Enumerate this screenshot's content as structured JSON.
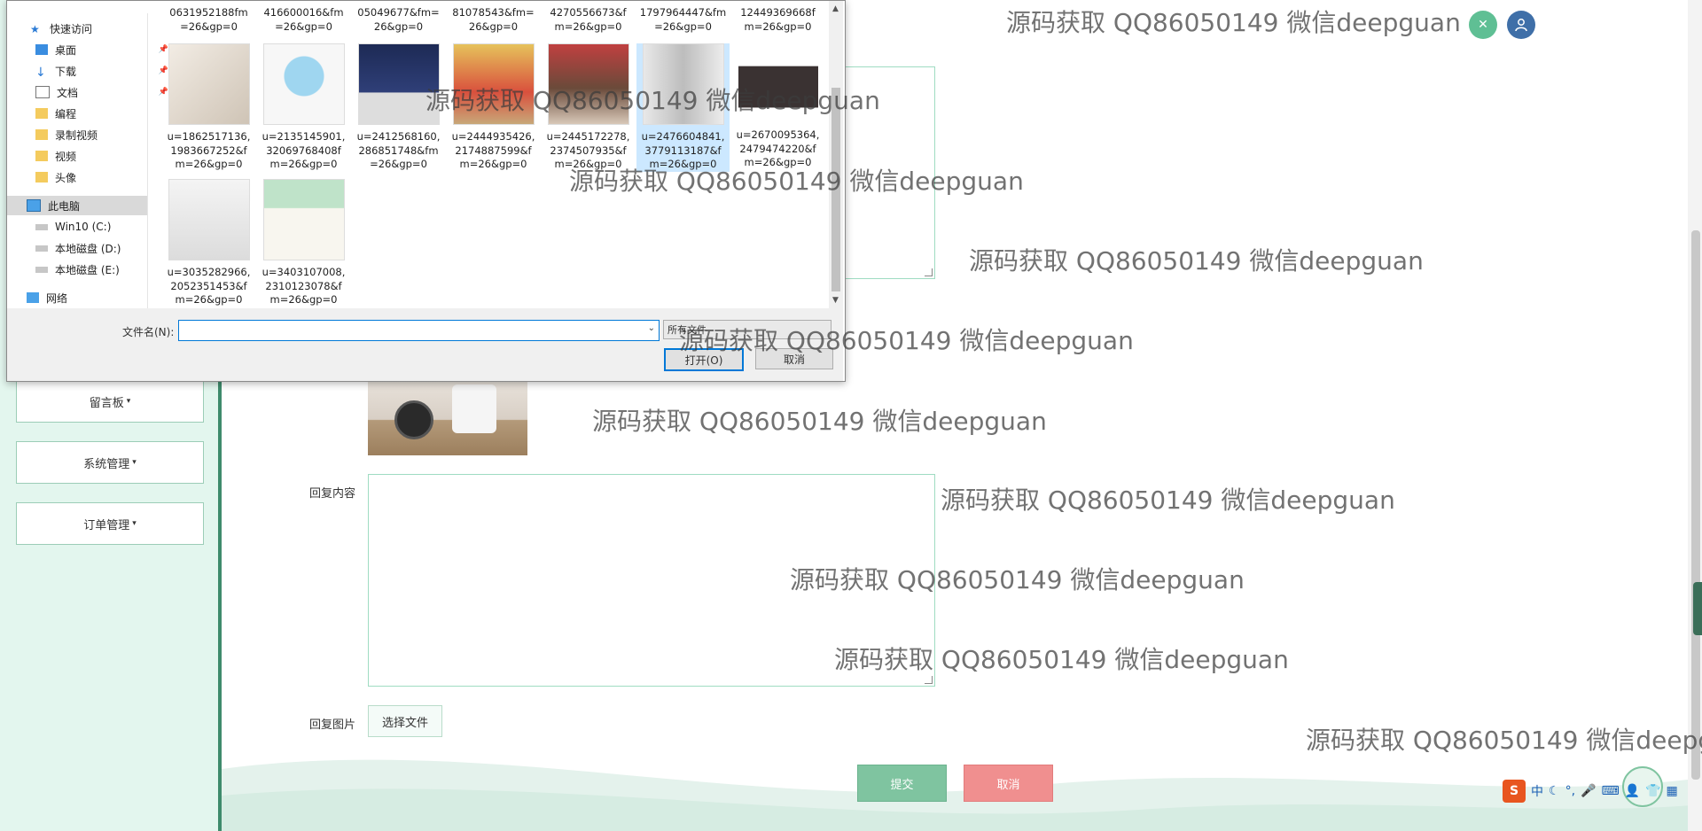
{
  "sidebar": {
    "items": [
      {
        "label": "留言板",
        "caret": "▾"
      },
      {
        "label": "系统管理",
        "caret": "▾"
      },
      {
        "label": "订单管理",
        "caret": "▾"
      }
    ]
  },
  "form": {
    "reply_content_label": "回复内容",
    "reply_image_label": "回复图片",
    "choose_file": "选择文件",
    "submit": "提交",
    "cancel": "取消"
  },
  "header": {
    "close_icon": "✕",
    "user_icon": "user-icon"
  },
  "dialog": {
    "nav": [
      {
        "label": "快速访问",
        "icon": "star-icon"
      },
      {
        "label": "桌面",
        "icon": "desktop-icon",
        "pinned": true
      },
      {
        "label": "下载",
        "icon": "download-icon",
        "pinned": true
      },
      {
        "label": "文档",
        "icon": "document-icon",
        "pinned": true
      },
      {
        "label": "编程",
        "icon": "folder-icon"
      },
      {
        "label": "录制视频",
        "icon": "folder-icon"
      },
      {
        "label": "视频",
        "icon": "folder-icon"
      },
      {
        "label": "头像",
        "icon": "folder-icon"
      },
      {
        "label": "此电脑",
        "icon": "computer-icon"
      },
      {
        "label": "Win10 (C:)",
        "icon": "drive-icon"
      },
      {
        "label": "本地磁盘 (D:)",
        "icon": "drive-icon"
      },
      {
        "label": "本地磁盘 (E:)",
        "icon": "drive-icon"
      },
      {
        "label": "网络",
        "icon": "network-icon"
      }
    ],
    "top_row": [
      [
        "0631952188fm",
        "=26&gp=0"
      ],
      [
        "416600016&fm",
        "=26&gp=0"
      ],
      [
        "05049677&fm=",
        "26&gp=0"
      ],
      [
        "81078543&fm=",
        "26&gp=0"
      ],
      [
        "4270556673&f",
        "m=26&gp=0"
      ],
      [
        "1797964447&fm",
        "=26&gp=0"
      ],
      [
        "12449369668f",
        "m=26&gp=0"
      ]
    ],
    "files": [
      [
        "u=1862517136,",
        "1983667252&f",
        "m=26&gp=0"
      ],
      [
        "u=2135145901,",
        "32069768408f",
        "m=26&gp=0"
      ],
      [
        "u=2412568160,",
        "286851748&fm",
        "=26&gp=0"
      ],
      [
        "u=2444935426,",
        "2174887599&f",
        "m=26&gp=0"
      ],
      [
        "u=2445172278,",
        "2374507935&f",
        "m=26&gp=0"
      ],
      [
        "u=2476604841,",
        "3779113187&f",
        "m=26&gp=0"
      ],
      [
        "u=2670095364,",
        "2479474220&f",
        "m=26&gp=0"
      ],
      [
        "u=3035282966,",
        "2052351453&f",
        "m=26&gp=0"
      ],
      [
        "u=3403107008,",
        "2310123078&f",
        "m=26&gp=0"
      ]
    ],
    "filename_label": "文件名(N):",
    "filename_value": "",
    "filetype": "所有文件",
    "open": "打开(O)",
    "cancel": "取消"
  },
  "watermark": "源码获取 QQ86050149 微信deepguan",
  "ime": {
    "zh": "中"
  }
}
